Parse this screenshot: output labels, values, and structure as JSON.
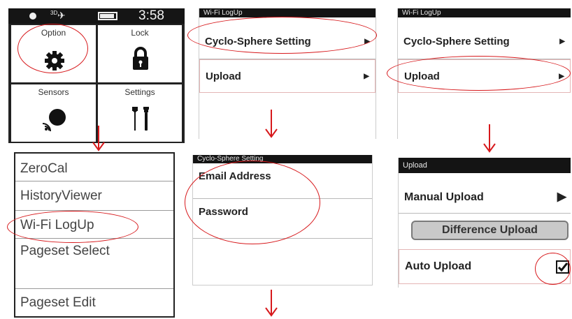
{
  "device": {
    "status_time": "3:58",
    "status_gps": "3D",
    "tiles": [
      {
        "label": "Option",
        "icon": "gear-icon"
      },
      {
        "label": "Lock",
        "icon": "lock-icon"
      },
      {
        "label": "Sensors",
        "icon": "sensor-icon"
      },
      {
        "label": "Settings",
        "icon": "tools-icon"
      }
    ]
  },
  "menu": {
    "items": [
      "ZeroCal",
      "HistoryViewer",
      "Wi-Fi LogUp",
      "Pageset Select",
      "Pageset Edit"
    ]
  },
  "wifi_screen_1": {
    "title": "Wi-Fi LogUp",
    "items": [
      "Cyclo-Sphere Setting",
      "Upload"
    ]
  },
  "wifi_screen_2": {
    "title": "Wi-Fi LogUp",
    "items": [
      "Cyclo-Sphere Setting",
      "Upload"
    ]
  },
  "cyclosphere": {
    "title": "Cyclo-Sphere Setting",
    "items": [
      "Email Address",
      "Password"
    ]
  },
  "upload": {
    "title": "Upload",
    "manual_label": "Manual Upload",
    "difference_label": "Difference Upload",
    "auto_label": "Auto Upload",
    "auto_checked": true
  },
  "colors": {
    "annotation": "#d7191c",
    "titlebar": "#141414",
    "highlight_row": "#e4b5b5"
  }
}
